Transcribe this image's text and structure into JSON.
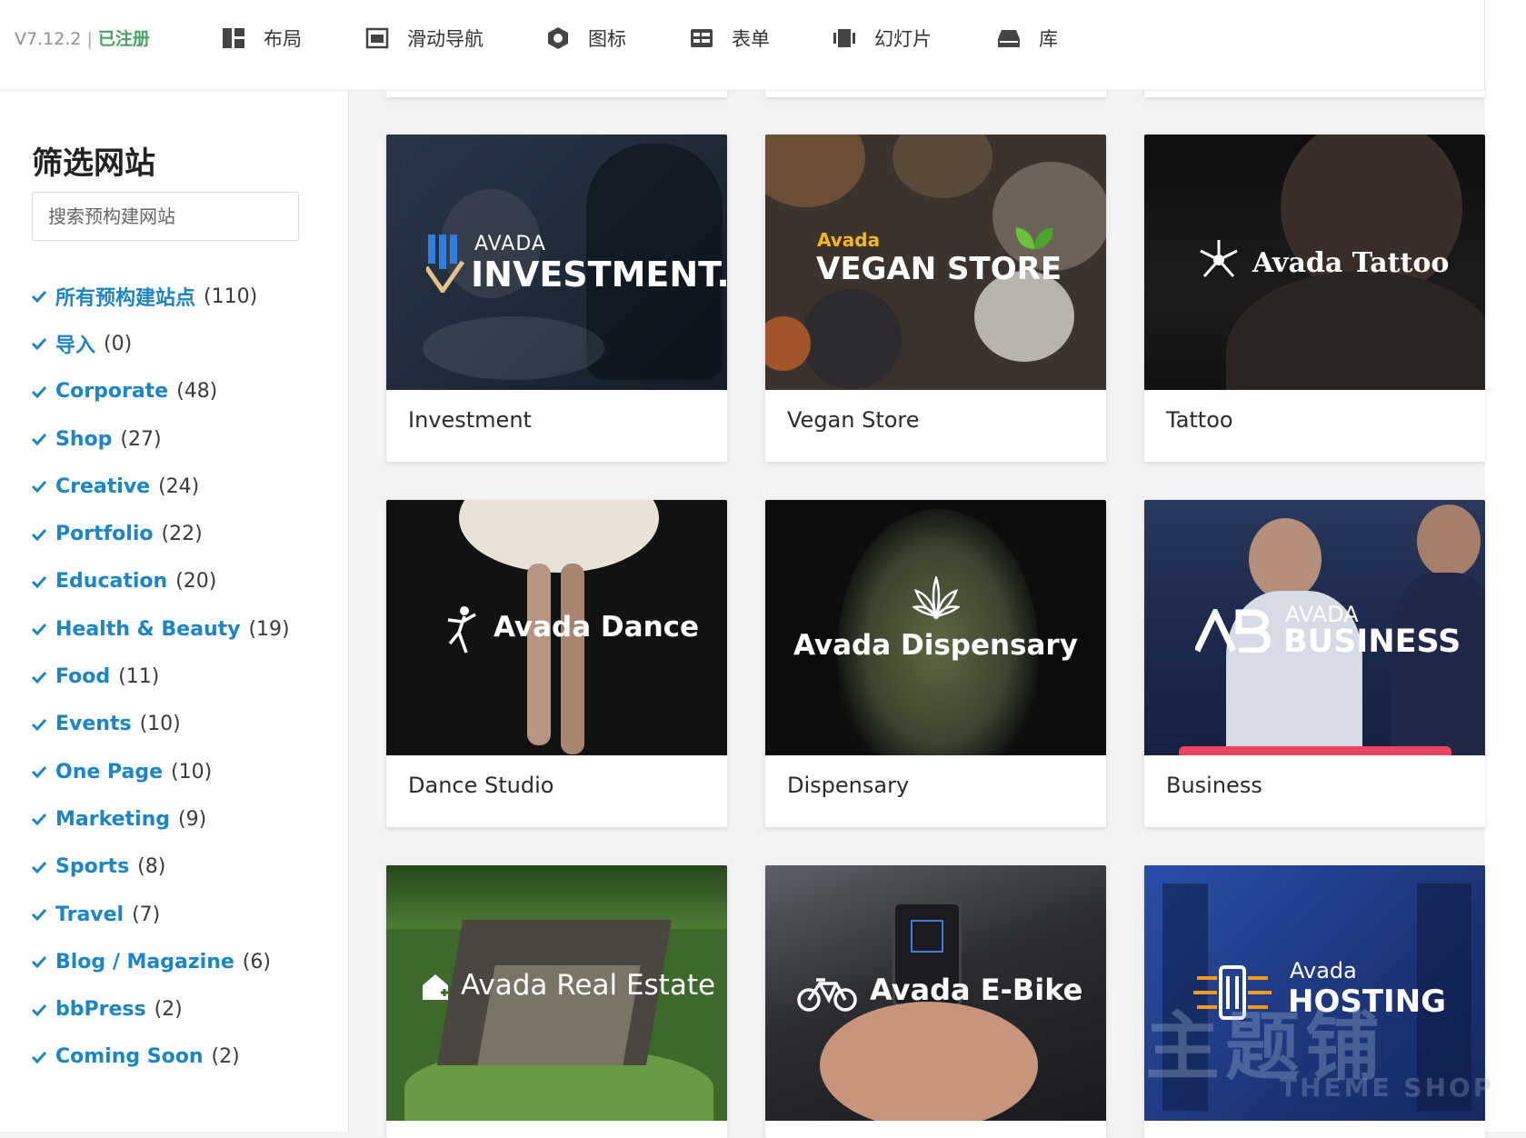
{
  "header": {
    "version": "V7.12.2",
    "separator": "|",
    "registered": "已注册",
    "nav": [
      {
        "label": "布局",
        "icon": "layout-icon"
      },
      {
        "label": "滑动导航",
        "icon": "slider-nav-icon"
      },
      {
        "label": "图标",
        "icon": "icons-icon"
      },
      {
        "label": "表单",
        "icon": "form-icon"
      },
      {
        "label": "幻灯片",
        "icon": "slideshow-icon"
      },
      {
        "label": "库",
        "icon": "library-icon"
      }
    ]
  },
  "sidebar": {
    "title": "筛选网站",
    "search_placeholder": "搜索预构建网站",
    "filters": [
      {
        "name": "所有预构建站点",
        "count": "(110)"
      },
      {
        "name": "导入",
        "count": "(0)"
      },
      {
        "name": "Corporate",
        "count": "(48)"
      },
      {
        "name": "Shop",
        "count": "(27)"
      },
      {
        "name": "Creative",
        "count": "(24)"
      },
      {
        "name": "Portfolio",
        "count": "(22)"
      },
      {
        "name": "Education",
        "count": "(20)"
      },
      {
        "name": "Health & Beauty",
        "count": "(19)"
      },
      {
        "name": "Food",
        "count": "(11)"
      },
      {
        "name": "Events",
        "count": "(10)"
      },
      {
        "name": "One Page",
        "count": "(10)"
      },
      {
        "name": "Marketing",
        "count": "(9)"
      },
      {
        "name": "Sports",
        "count": "(8)"
      },
      {
        "name": "Travel",
        "count": "(7)"
      },
      {
        "name": "Blog / Magazine",
        "count": "(6)"
      },
      {
        "name": "bbPress",
        "count": "(2)"
      },
      {
        "name": "Coming Soon",
        "count": "(2)"
      }
    ]
  },
  "cards": [
    {
      "title": "Investment",
      "brand_small": "AVADA",
      "brand_big": "INVESTMENT."
    },
    {
      "title": "Vegan Store",
      "brand_small": "Avada",
      "brand_big": "VEGAN STORE"
    },
    {
      "title": "Tattoo",
      "brand_big": "Avada Tattoo"
    },
    {
      "title": "Dance Studio",
      "brand_big": "Avada Dance"
    },
    {
      "title": "Dispensary",
      "brand_big": "Avada Dispensary"
    },
    {
      "title": "Business",
      "brand_small": "AVADA",
      "brand_big": "BUSINESS"
    },
    {
      "brand_big": "Avada Real Estate"
    },
    {
      "brand_big": "Avada E-Bike"
    },
    {
      "brand_small": "Avada",
      "brand_big": "HOSTING"
    }
  ],
  "watermark": {
    "main": "主题铺",
    "sub": "THEME SHOP"
  },
  "colors": {
    "link": "#1b85c8",
    "registered": "#4aa362",
    "accent_bar": "#e8455e"
  }
}
